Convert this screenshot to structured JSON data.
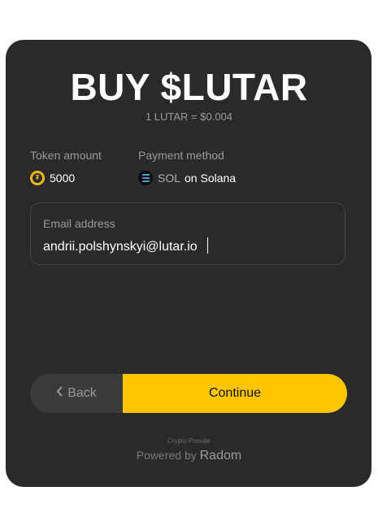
{
  "header": {
    "title": "BUY $LUTAR",
    "rate": "1 LUTAR = $0.004"
  },
  "token": {
    "label": "Token amount",
    "amount": "5000",
    "icon": "lutar-coin-icon"
  },
  "payment": {
    "label": "Payment method",
    "symbol": "SOL",
    "network": "on Solana",
    "icon": "solana-icon"
  },
  "email": {
    "label": "Email address",
    "value": "andrii.polshynskyi@lutar.io"
  },
  "buttons": {
    "back_label": "Back",
    "continue_label": "Continue"
  },
  "footer": {
    "presale": "Crypto Presale",
    "powered_by": "Powered by",
    "brand": "Radom"
  },
  "colors": {
    "card_bg": "#2a2a2a",
    "accent": "#fdc500"
  }
}
